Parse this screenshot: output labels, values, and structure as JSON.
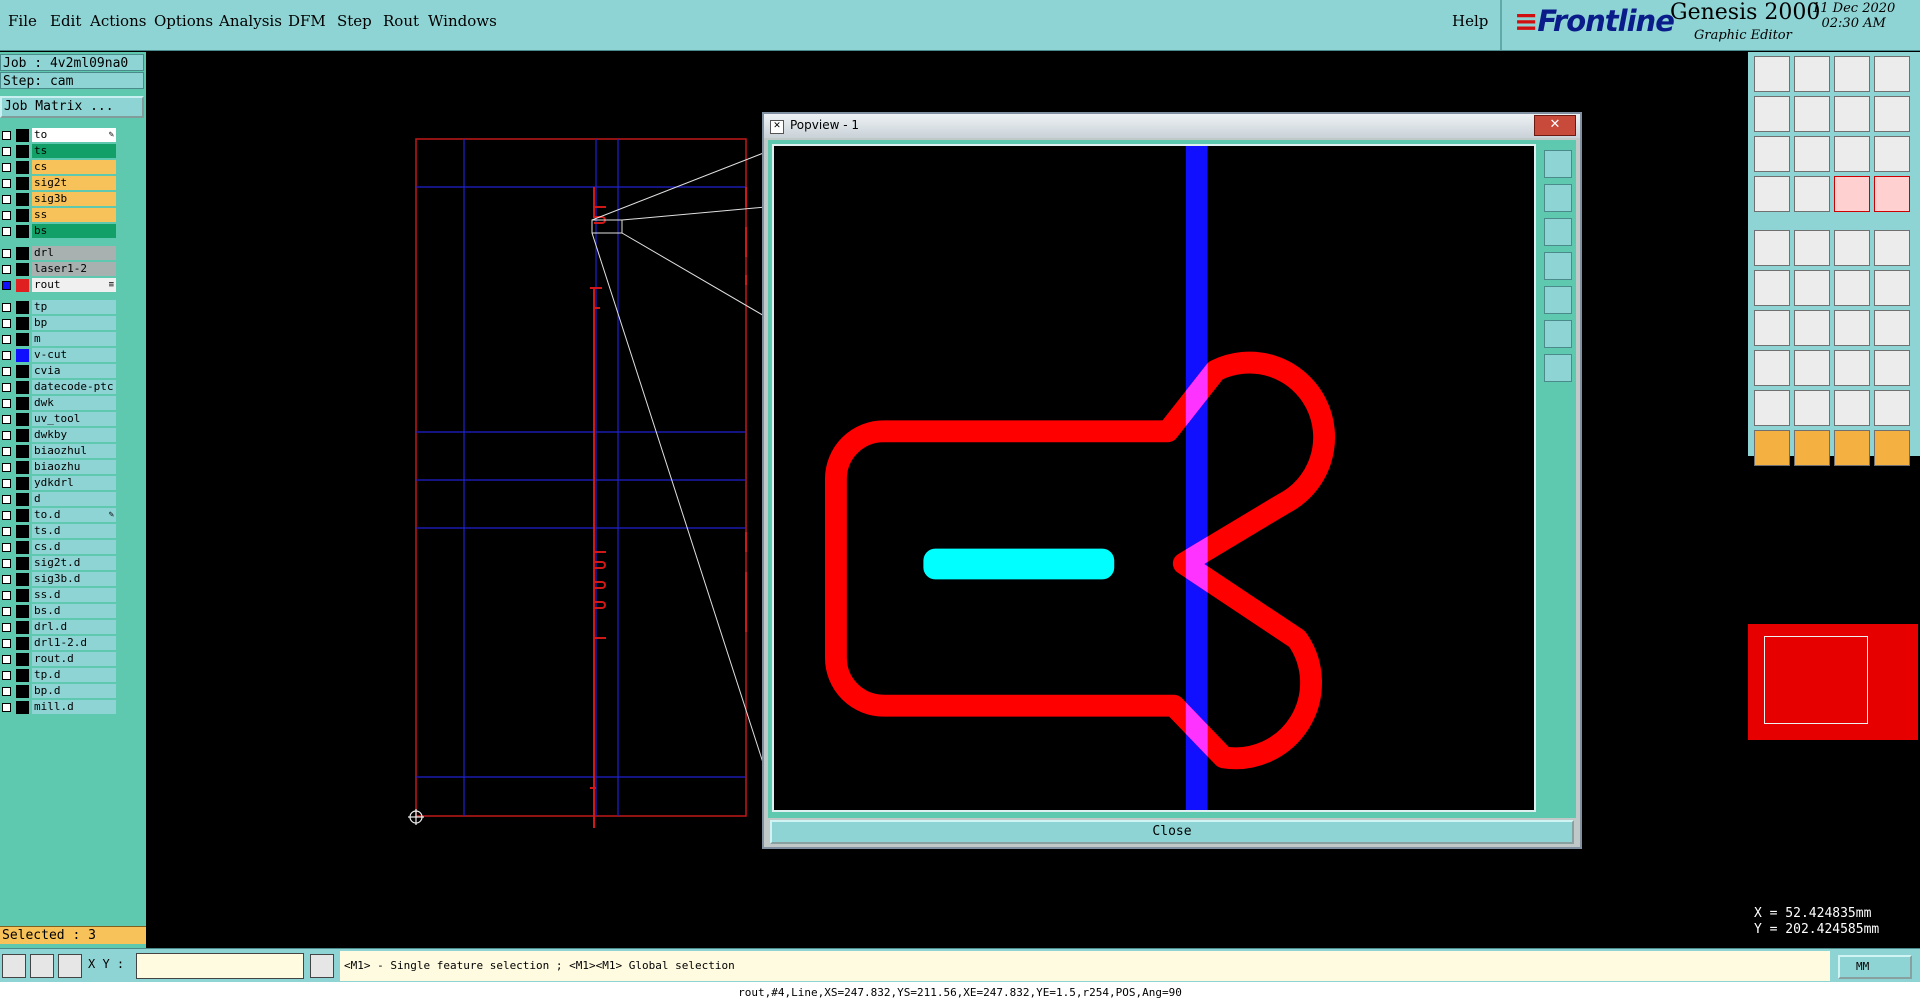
{
  "menu": [
    "File",
    "Edit",
    "Actions",
    "Options",
    "Analysis",
    "DFM",
    "Step",
    "Rout",
    "Windows"
  ],
  "help": "Help",
  "brand": {
    "logo": "Frontline",
    "product": "Genesis 2000",
    "subtitle": "Graphic Editor",
    "date": "11 Dec 2020",
    "time": "02:30 AM"
  },
  "job": "Job : 4v2ml09na0",
  "step": "Step: cam",
  "job_matrix": "Job Matrix ...",
  "layers": [
    {
      "name": "to",
      "color": "#ffffff",
      "tag": "✎"
    },
    {
      "name": "ts",
      "color": "#12a068"
    },
    {
      "name": "cs",
      "color": "#f7c25a"
    },
    {
      "name": "sig2t",
      "color": "#f7c25a"
    },
    {
      "name": "sig3b",
      "color": "#f7c25a"
    },
    {
      "name": "ss",
      "color": "#f7c25a"
    },
    {
      "name": "bs",
      "color": "#12a068"
    },
    {
      "name": "drl",
      "color": "#a8b0b0"
    },
    {
      "name": "laser1-2",
      "color": "#a8b0b0"
    },
    {
      "name": "rout",
      "color": "#f0f0f0",
      "tag": "≡"
    },
    {
      "name": "tp",
      "color": "#8fd4d4"
    },
    {
      "name": "bp",
      "color": "#8fd4d4"
    },
    {
      "name": "m",
      "color": "#8fd4d4"
    },
    {
      "name": "v-cut",
      "color": "#8fd4d4"
    },
    {
      "name": "cvia",
      "color": "#8fd4d4"
    },
    {
      "name": "datecode-ptc",
      "color": "#8fd4d4"
    },
    {
      "name": "dwk",
      "color": "#8fd4d4"
    },
    {
      "name": "uv_tool",
      "color": "#8fd4d4"
    },
    {
      "name": "dwkby",
      "color": "#8fd4d4"
    },
    {
      "name": "biaozhul",
      "color": "#8fd4d4"
    },
    {
      "name": "biaozhu",
      "color": "#8fd4d4"
    },
    {
      "name": "ydkdrl",
      "color": "#8fd4d4"
    },
    {
      "name": "d",
      "color": "#8fd4d4"
    },
    {
      "name": "to.d",
      "color": "#8fd4d4",
      "tag": "✎"
    },
    {
      "name": "ts.d",
      "color": "#8fd4d4"
    },
    {
      "name": "cs.d",
      "color": "#8fd4d4"
    },
    {
      "name": "sig2t.d",
      "color": "#8fd4d4"
    },
    {
      "name": "sig3b.d",
      "color": "#8fd4d4"
    },
    {
      "name": "ss.d",
      "color": "#8fd4d4"
    },
    {
      "name": "bs.d",
      "color": "#8fd4d4"
    },
    {
      "name": "drl.d",
      "color": "#8fd4d4"
    },
    {
      "name": "drl1-2.d",
      "color": "#8fd4d4"
    },
    {
      "name": "rout.d",
      "color": "#8fd4d4"
    },
    {
      "name": "tp.d",
      "color": "#8fd4d4"
    },
    {
      "name": "bp.d",
      "color": "#8fd4d4"
    },
    {
      "name": "mill.d",
      "color": "#8fd4d4"
    }
  ],
  "selected": "Selected : 3",
  "popview": {
    "title": "Popview - 1",
    "close_x": "✕",
    "close": "Close"
  },
  "coords": {
    "x": "X = 52.424835mm",
    "y": "Y = 202.424585mm"
  },
  "xy_label": "X Y :",
  "prompt": "<M1> - Single feature selection ; <M1><M1> Global selection",
  "units": "MM",
  "status": "rout,#4,Line,XS=247.832,YS=211.56,XE=247.832,YE=1.5,r254,POS,Ang=90",
  "colors": {
    "rout": "#ff0000",
    "vcut": "#1010ff",
    "highlight": "#ff33ff",
    "selected": "#00ffff",
    "panel": "#8fd4d4"
  }
}
